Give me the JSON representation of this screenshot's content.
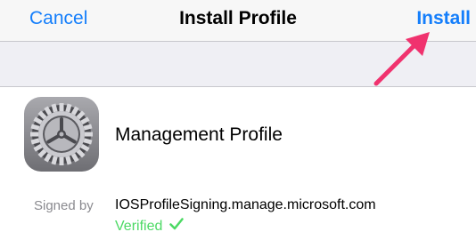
{
  "navbar": {
    "cancel_label": "Cancel",
    "title": "Install Profile",
    "install_label": "Install"
  },
  "profile": {
    "name": "Management Profile",
    "icon": "settings-gear-icon"
  },
  "signature": {
    "signed_by_label": "Signed by",
    "signer": "IOSProfileSigning.manage.microsoft.com",
    "status": "Verified",
    "status_icon": "checkmark-icon"
  },
  "colors": {
    "accent": "#147efb",
    "verified": "#4cd964",
    "annotation_arrow": "#f0326e"
  }
}
